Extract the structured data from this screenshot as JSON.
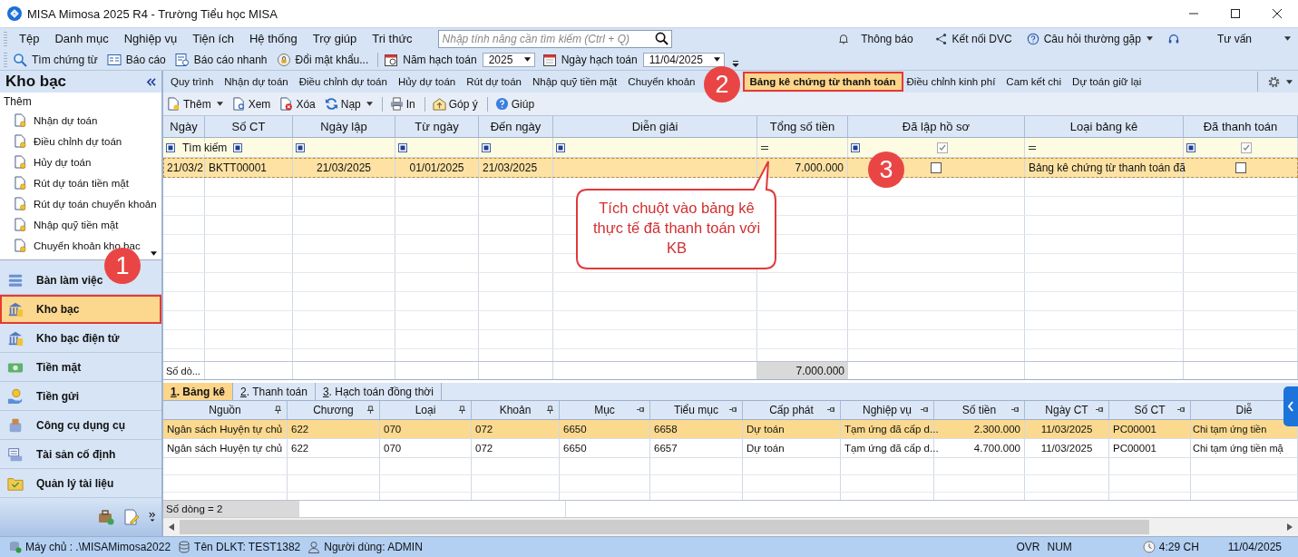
{
  "window": {
    "title": "MISA Mimosa 2025 R4 - Trường Tiểu học MISA"
  },
  "menu": [
    "Tệp",
    "Danh mục",
    "Nghiệp vụ",
    "Tiện ích",
    "Hệ thống",
    "Trợ giúp",
    "Tri thức"
  ],
  "search": {
    "placeholder": "Nhập tính năng cần tìm kiếm (Ctrl + Q)"
  },
  "header_links": [
    {
      "kind": "bell",
      "label": "Thông báo",
      "dropdown": false
    },
    {
      "kind": "share",
      "label": "Kết nối DVC",
      "dropdown": false
    },
    {
      "kind": "help",
      "label": "Câu hỏi thường gặp",
      "dropdown": true
    },
    {
      "kind": "headset",
      "label": "Tư vấn",
      "dropdown": true
    }
  ],
  "toolbar": [
    {
      "kind": "search",
      "label": "Tìm chứng từ"
    },
    {
      "kind": "report",
      "label": "Báo cáo"
    },
    {
      "kind": "quick_report",
      "label": "Báo cáo nhanh"
    },
    {
      "kind": "password",
      "label": "Đổi mật khẩu..."
    }
  ],
  "fiscal_year": {
    "label": "Năm hạch toán",
    "value": "2025"
  },
  "posting_date": {
    "label": "Ngày hạch toán",
    "value": "11/04/2025"
  },
  "sidebar": {
    "title": "Kho bạc",
    "section": "Thêm",
    "items": [
      "Nhận dự toán",
      "Điều chỉnh dự toán",
      "Hủy dự toán",
      "Rút dự toán tiền mặt",
      "Rút dự toán chuyển khoản",
      "Nhập quỹ tiền mặt",
      "Chuyển khoản kho bạc"
    ],
    "nav": [
      {
        "kind": "desk",
        "label": "Bàn làm việc",
        "selected": false,
        "outlined": false
      },
      {
        "kind": "treasury",
        "label": "Kho bạc",
        "selected": true,
        "outlined": true
      },
      {
        "kind": "e_treasury",
        "label": "Kho bạc điện tử",
        "selected": false,
        "outlined": false
      },
      {
        "kind": "cash",
        "label": "Tiền mặt",
        "selected": false,
        "outlined": false
      },
      {
        "kind": "deposit",
        "label": "Tiền gửi",
        "selected": false,
        "outlined": false
      },
      {
        "kind": "tools",
        "label": "Công cụ dụng cụ",
        "selected": false,
        "outlined": false
      },
      {
        "kind": "assets",
        "label": "Tài sản cố định",
        "selected": false,
        "outlined": false
      },
      {
        "kind": "documents",
        "label": "Quản lý tài liệu",
        "selected": false,
        "outlined": false
      }
    ]
  },
  "module_tabs": [
    {
      "label": "Quy trình",
      "selected": false,
      "outlined": false
    },
    {
      "label": "Nhận dự toán",
      "selected": false,
      "outlined": false
    },
    {
      "label": "Điều chỉnh dự toán",
      "selected": false,
      "outlined": false
    },
    {
      "label": "Hủy dự toán",
      "selected": false,
      "outlined": false
    },
    {
      "label": "Rút dự toán",
      "selected": false,
      "outlined": false
    },
    {
      "label": "Nhập quỹ tiền mặt",
      "selected": false,
      "outlined": false
    },
    {
      "label": "Chuyển khoản",
      "selected": false,
      "outlined": false
    },
    {
      "label": "Bảng kê chứng từ thanh toán",
      "selected": true,
      "outlined": true
    },
    {
      "label": "Điều chỉnh kinh phí",
      "selected": false,
      "outlined": false
    },
    {
      "label": "Cam kết chi",
      "selected": false,
      "outlined": false
    },
    {
      "label": "Dự toán giữ lại",
      "selected": false,
      "outlined": false
    }
  ],
  "actions": [
    {
      "kind": "add",
      "label": "Thêm",
      "dropdown": true
    },
    {
      "kind": "view",
      "label": "Xem",
      "dropdown": false
    },
    {
      "kind": "delete",
      "label": "Xóa",
      "dropdown": false
    },
    {
      "kind": "reload",
      "label": "Nạp",
      "dropdown": true
    },
    {
      "kind": "print",
      "label": "In",
      "dropdown": false
    },
    {
      "kind": "feedback",
      "label": "Góp ý",
      "dropdown": false
    },
    {
      "kind": "help",
      "label": "Giúp",
      "dropdown": false
    }
  ],
  "table": {
    "filter_placeholder": "Tìm kiếm",
    "columns": [
      {
        "label": "Ngày",
        "kind": "text",
        "filter": {
          "kind": "square"
        }
      },
      {
        "label": "Số CT",
        "kind": "text",
        "filter": {
          "kind": "square"
        }
      },
      {
        "label": "Ngày lập",
        "kind": "date",
        "filter": {
          "kind": "square"
        }
      },
      {
        "label": "Từ ngày",
        "kind": "date",
        "filter": {
          "kind": "square"
        }
      },
      {
        "label": "Đến ngày",
        "kind": "text",
        "filter": {
          "kind": "square"
        }
      },
      {
        "label": "Diễn giải",
        "kind": "text",
        "filter": {
          "kind": "square"
        }
      },
      {
        "label": "Tổng số tiền",
        "kind": "money",
        "filter": {
          "kind": "equals"
        }
      },
      {
        "label": "Đã lập hồ sơ",
        "kind": "check",
        "filter": {
          "kind": "square"
        },
        "filter_checked": true
      },
      {
        "label": "Loại bảng kê",
        "kind": "text",
        "filter": {
          "kind": "equals"
        }
      },
      {
        "label": "Đã thanh toán",
        "kind": "check",
        "filter": {
          "kind": "square"
        },
        "filter_checked": true
      }
    ],
    "rows": [
      {
        "selected": true,
        "cells": [
          {
            "text": "21/03/2"
          },
          {
            "text": "BKTT00001"
          },
          {
            "text": "21/03/2025"
          },
          {
            "text": "01/01/2025"
          },
          {
            "text": "21/03/2025"
          },
          {},
          {
            "text": "7.000.000"
          },
          {
            "checked": false
          },
          {
            "text": "Bảng kê chứng từ thanh toán đã"
          },
          {
            "checked": false
          }
        ]
      }
    ],
    "footer": {
      "label": "Số dò...",
      "total": "7.000.000"
    }
  },
  "detail_tabs": [
    {
      "label": "1. Bảng kê",
      "selected": true
    },
    {
      "label": "2. Thanh toán",
      "selected": false
    },
    {
      "label": "3. Hạch toán đồng thời",
      "selected": false
    }
  ],
  "detail_table": {
    "columns": [
      {
        "label": "Nguồn",
        "kind": "text",
        "pin": {
          "kind": "pin"
        }
      },
      {
        "label": "Chương",
        "kind": "text",
        "pin": {
          "kind": "pin"
        }
      },
      {
        "label": "Loại",
        "kind": "text",
        "pin": {
          "kind": "pin"
        }
      },
      {
        "label": "Khoản",
        "kind": "text",
        "pin": {
          "kind": "pin"
        }
      },
      {
        "label": "Mục",
        "kind": "text",
        "pin": {
          "kind": "side"
        }
      },
      {
        "label": "Tiểu mục",
        "kind": "text",
        "pin": {
          "kind": "side"
        }
      },
      {
        "label": "Cấp phát",
        "kind": "text",
        "pin": {
          "kind": "side"
        }
      },
      {
        "label": "Nghiệp vụ",
        "kind": "text",
        "pin": {
          "kind": "side"
        }
      },
      {
        "label": "Số tiền",
        "kind": "money",
        "pin": {
          "kind": "side"
        }
      },
      {
        "label": "Ngày CT",
        "kind": "date",
        "pin": {
          "kind": "side"
        }
      },
      {
        "label": "Số CT",
        "kind": "text",
        "pin": {
          "kind": "side"
        }
      },
      {
        "label": "Diễ",
        "kind": "text"
      }
    ],
    "rows": [
      {
        "selected": true,
        "cells": [
          "Ngân sách Huyện tự chủ",
          "622",
          "070",
          "072",
          "6650",
          "6658",
          "Dự toán",
          "Tạm ứng đã cấp d...",
          "2.300.000",
          "11/03/2025",
          "PC00001",
          "Chi tạm ứng tiền"
        ]
      },
      {
        "selected": false,
        "cells": [
          "Ngân sách Huyện tự chủ",
          "622",
          "070",
          "072",
          "6650",
          "6657",
          "Dự toán",
          "Tạm ứng đã cấp d...",
          "4.700.000",
          "11/03/2025",
          "PC00001",
          "Chi tạm ứng tiền mặ"
        ]
      }
    ],
    "footer": "Số dòng = 2"
  },
  "status_bar": {
    "server": "Máy chủ : .\\MISAMimosa2022",
    "database": "Tên DLKT: TEST1382",
    "user": "Người dùng: ADMIN",
    "modes": [
      "OVR",
      "NUM"
    ],
    "time": "4:29 CH",
    "date": "11/04/2025"
  },
  "annotations": [
    {
      "number": "1"
    },
    {
      "number": "2"
    },
    {
      "number": "3"
    }
  ],
  "callout": {
    "text": "Tích chuột vào bảng kê thực tế đã thanh toán với KB"
  }
}
